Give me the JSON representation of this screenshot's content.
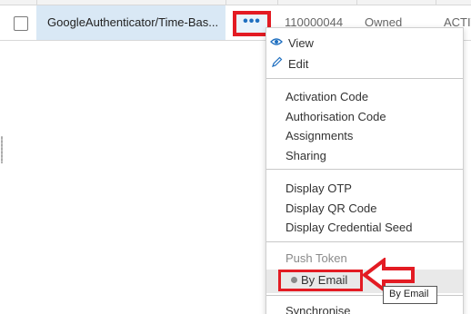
{
  "table": {
    "row": {
      "name": "GoogleAuthenticator/Time-Bas...",
      "id": "110000044",
      "ownership": "Owned",
      "status": "ACTIV"
    },
    "actions_button_label": "•••"
  },
  "menu": {
    "view_label": "View",
    "edit_label": "Edit",
    "activation_code_label": "Activation Code",
    "authorisation_code_label": "Authorisation Code",
    "assignments_label": "Assignments",
    "sharing_label": "Sharing",
    "display_otp_label": "Display OTP",
    "display_qr_code_label": "Display QR Code",
    "display_credential_seed_label": "Display Credential Seed",
    "push_token_label": "Push Token",
    "by_email_label": "By Email",
    "synchronise_label": "Synchronise"
  },
  "tooltip": {
    "text": "By Email"
  },
  "colors": {
    "highlight_red": "#e31b23",
    "row_selected": "#d9e8f5",
    "link_blue": "#1f6fc0"
  },
  "icons": {
    "view": "eye-icon",
    "edit": "pencil-icon",
    "annotation": "arrow-left-icon"
  }
}
